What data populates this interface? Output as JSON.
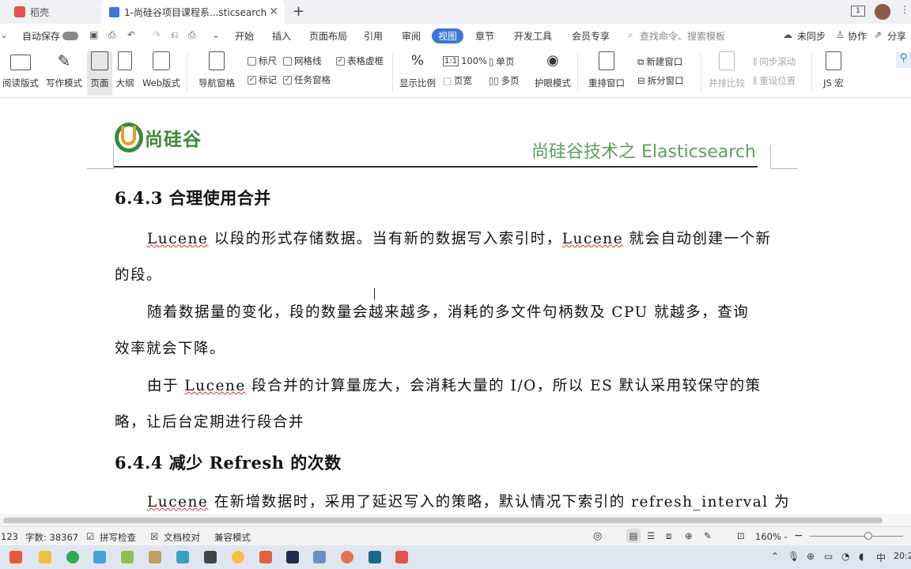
{
  "tabs": [
    {
      "label": "稻壳"
    },
    {
      "label": "1-尚硅谷项目课程系...sticsearch"
    }
  ],
  "menu": {
    "items": [
      "开始",
      "插入",
      "页面布局",
      "引用",
      "审阅",
      "视图",
      "章节",
      "开发工具",
      "会员专享"
    ],
    "active": "视图",
    "autosave_label": "自动保存",
    "search_placeholder": "查找命令、搜索模板",
    "unsynced": "未同步",
    "collab": "协作",
    "share": "分享"
  },
  "toolbar": {
    "read_mode": "阅读版式",
    "write_mode": "写作模式",
    "page": "页面",
    "outline": "大纲",
    "web": "Web版式",
    "nav_pane": "导航窗格",
    "ruler": "标尺",
    "gridlines": "网格线",
    "table_gridlines": "表格虚框",
    "marks": "标记",
    "task_pane": "任务窗格",
    "zoom_ratio": "显示比例",
    "zoom_100": "100%",
    "page_width": "页宽",
    "single_page": "单页",
    "multi_page": "多页",
    "eye_protect": "护眼模式",
    "rearrange": "重排窗口",
    "new_window": "新建窗口",
    "split_window": "拆分窗口",
    "side_by_side": "并排比较",
    "sync_scroll": "同步滚动",
    "reset_position": "重设位置",
    "js_macro": "JS 宏"
  },
  "document": {
    "logo_text": "尚硅谷",
    "header_right": "尚硅谷技术之 Elasticsearch",
    "h1": "6.4.3  合理使用合并",
    "p1_line1_a": "Lucene",
    "p1_line1_b": " 以段的形式存储数据。当有新的数据写入索引时，",
    "p1_line1_c": "Lucene",
    "p1_line1_d": " 就会自动创建一个新",
    "p1_line2": "的段。",
    "p2_line1": "随着数据量的变化，段的数量会越来越多，消耗的多文件句柄数及 CPU 就越多，查询",
    "p2_line2": "效率就会下降。",
    "p3_line1_a": "由于 ",
    "p3_line1_b": "Lucene",
    "p3_line1_c": " 段合并的计算量庞大，会消耗大量的 I/O，所以 ES 默认采用较保守的策",
    "p3_line2": "略，让后台定期进行段合并",
    "h2": "6.4.4  减少 Refresh 的次数",
    "p4_line1_a": "Lucene",
    "p4_line1_b": " 在新增数据时，采用了延迟写入的策略，默认情况下索引的 refresh_interval 为"
  },
  "status": {
    "page_num": "123",
    "word_count": "字数: 38367",
    "spell_check": "拼写检查",
    "doc_proof": "文档校对",
    "compat_mode": "兼容模式",
    "zoom": "160% -"
  },
  "taskbar": {
    "ime": "中",
    "clock": "20:2"
  },
  "colors": {
    "accent": "#3a78d8",
    "logo_green": "#3a8a3c",
    "header_green": "#5ea05e"
  }
}
